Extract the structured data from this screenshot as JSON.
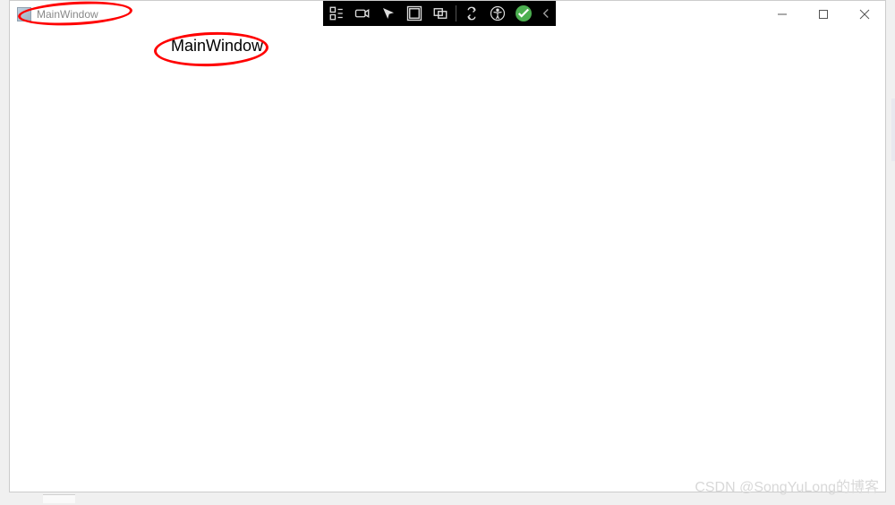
{
  "titlebar": {
    "title": "MainWindow",
    "controls": {
      "minimize": "Minimize",
      "maximize": "Maximize",
      "close": "Close"
    }
  },
  "debug_toolbar": {
    "items": [
      "live-tree-icon",
      "record-icon",
      "select-element-icon",
      "layout-adorners-icon",
      "track-focus-icon",
      "hot-reload-icon",
      "accessibility-icon",
      "status-ok-icon",
      "collapse-icon"
    ]
  },
  "content": {
    "label_text": "MainWindow"
  },
  "annotations": {
    "ellipse1": "highlight-title",
    "ellipse2": "highlight-label"
  },
  "watermark": "CSDN @SongYuLong的博客"
}
